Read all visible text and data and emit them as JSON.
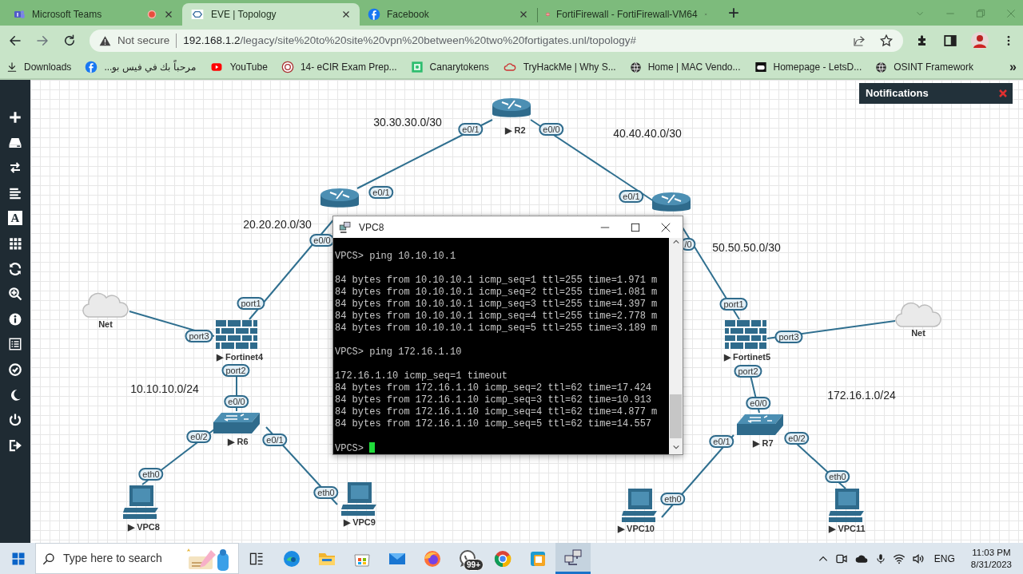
{
  "browser": {
    "tabs": [
      {
        "title": "Microsoft Teams",
        "selected": false,
        "recording": true,
        "kind": "teams"
      },
      {
        "title": "EVE | Topology",
        "selected": true,
        "recording": false,
        "kind": "eve"
      },
      {
        "title": "Facebook",
        "selected": false,
        "recording": false,
        "kind": "facebook"
      },
      {
        "title": "FortiFirewall - FortiFirewall-VM64",
        "selected": false,
        "recording": false,
        "kind": "forti"
      }
    ],
    "new_tab": "+",
    "address": {
      "security": "Not secure",
      "host": "192.168.1.2",
      "path": "/legacy/site%20to%20site%20vpn%20between%20two%20fortigates.unl/topology#"
    },
    "bookmarks": [
      {
        "title": "Downloads",
        "kind": "download"
      },
      {
        "title": "مرحباً بك في فيس بو...",
        "kind": "facebook"
      },
      {
        "title": "YouTube",
        "kind": "youtube"
      },
      {
        "title": "14- eCIR Exam Prep...",
        "kind": "ecir"
      },
      {
        "title": "Canarytokens",
        "kind": "canary"
      },
      {
        "title": "TryHackMe | Why S...",
        "kind": "thm"
      },
      {
        "title": "Home | MAC Vendo...",
        "kind": "globe"
      },
      {
        "title": "Homepage - LetsD...",
        "kind": "letsd"
      },
      {
        "title": "OSINT Framework",
        "kind": "globe"
      }
    ],
    "bookmarks_more": "»"
  },
  "sidebar": {
    "text_tool_glyph": "A"
  },
  "topology": {
    "nodes": [
      {
        "kind": "router",
        "label": "▶ R2"
      },
      {
        "kind": "router"
      },
      {
        "kind": "router"
      },
      {
        "kind": "cloud",
        "label": "Net"
      },
      {
        "kind": "firewall",
        "label": "▶ Fortinet4"
      },
      {
        "kind": "firewall",
        "label": "▶ Fortinet5"
      },
      {
        "kind": "cloud",
        "label": "Net"
      },
      {
        "kind": "switch",
        "label": "▶ R6"
      },
      {
        "kind": "switch",
        "label": "▶ R7"
      },
      {
        "kind": "pc",
        "label": "▶ VPC8"
      },
      {
        "kind": "pc",
        "label": "▶ VPC9"
      },
      {
        "kind": "pc",
        "label": "▶ VPC10"
      },
      {
        "kind": "pc",
        "label": "▶ VPC11"
      }
    ],
    "links": [
      {
        "ports": [
          "e0/1",
          "e0/1"
        ]
      },
      {
        "ports": [
          "e0/0",
          "e0/1"
        ]
      },
      {
        "ports": [
          "e0/0",
          "port1"
        ]
      },
      {
        "ports": [
          "/0",
          "port1"
        ]
      },
      {
        "ports": [
          "port3"
        ]
      },
      {
        "ports": [
          "port3"
        ]
      },
      {
        "ports": [
          "port2",
          "e0/0"
        ]
      },
      {
        "ports": [
          "port2",
          "e0/0"
        ]
      },
      {
        "ports": [
          "e0/2",
          "eth0"
        ]
      },
      {
        "ports": [
          "e0/1",
          "eth0"
        ]
      },
      {
        "ports": [
          "e0/1",
          "eth0"
        ]
      },
      {
        "ports": [
          "e0/2",
          "eth0"
        ]
      }
    ],
    "networks": [
      "30.30.30.0/30",
      "40.40.40.0/30",
      "20.20.20.0/30",
      "50.50.50.0/30",
      "10.10.10.0/24",
      "172.16.1.0/24"
    ]
  },
  "notifications": {
    "title": "Notifications"
  },
  "terminal": {
    "title": "VPC8",
    "lines": [
      {
        "kind": "blank"
      },
      {
        "kind": "text",
        "text": "VPCS> ping 10.10.10.1"
      },
      {
        "kind": "blank"
      },
      {
        "kind": "text",
        "text": "84 bytes from 10.10.10.1 icmp_seq=1 ttl=255 time=1.971 m"
      },
      {
        "kind": "text",
        "text": "84 bytes from 10.10.10.1 icmp_seq=2 ttl=255 time=1.081 m"
      },
      {
        "kind": "text",
        "text": "84 bytes from 10.10.10.1 icmp_seq=3 ttl=255 time=4.397 m"
      },
      {
        "kind": "text",
        "text": "84 bytes from 10.10.10.1 icmp_seq=4 ttl=255 time=2.778 m"
      },
      {
        "kind": "text",
        "text": "84 bytes from 10.10.10.1 icmp_seq=5 ttl=255 time=3.189 m"
      },
      {
        "kind": "blank"
      },
      {
        "kind": "text",
        "text": "VPCS> ping 172.16.1.10"
      },
      {
        "kind": "blank"
      },
      {
        "kind": "text",
        "text": "172.16.1.10 icmp_seq=1 timeout"
      },
      {
        "kind": "text",
        "text": "84 bytes from 172.16.1.10 icmp_seq=2 ttl=62 time=17.424"
      },
      {
        "kind": "text",
        "text": "84 bytes from 172.16.1.10 icmp_seq=3 ttl=62 time=10.913"
      },
      {
        "kind": "text",
        "text": "84 bytes from 172.16.1.10 icmp_seq=4 ttl=62 time=4.877 m"
      },
      {
        "kind": "text",
        "text": "84 bytes from 172.16.1.10 icmp_seq=5 ttl=62 time=14.557"
      },
      {
        "kind": "blank"
      },
      {
        "kind": "text",
        "text": "VPCS>",
        "cursor": true
      }
    ]
  },
  "taskbar": {
    "search": {
      "placeholder": "Type here to search"
    },
    "apps": [
      {
        "kind": "taskview",
        "selected": false
      },
      {
        "kind": "edge",
        "selected": false
      },
      {
        "kind": "explorer",
        "selected": false
      },
      {
        "kind": "store",
        "selected": false
      },
      {
        "kind": "mail",
        "selected": false
      },
      {
        "kind": "firefox",
        "selected": false
      },
      {
        "kind": "whatsapp",
        "selected": false,
        "badge": "99+"
      },
      {
        "kind": "chrome",
        "selected": false
      },
      {
        "kind": "app",
        "selected": false
      },
      {
        "kind": "network",
        "selected": true
      }
    ],
    "language": "ENG",
    "time": "11:03 PM",
    "date": "8/31/2023"
  }
}
